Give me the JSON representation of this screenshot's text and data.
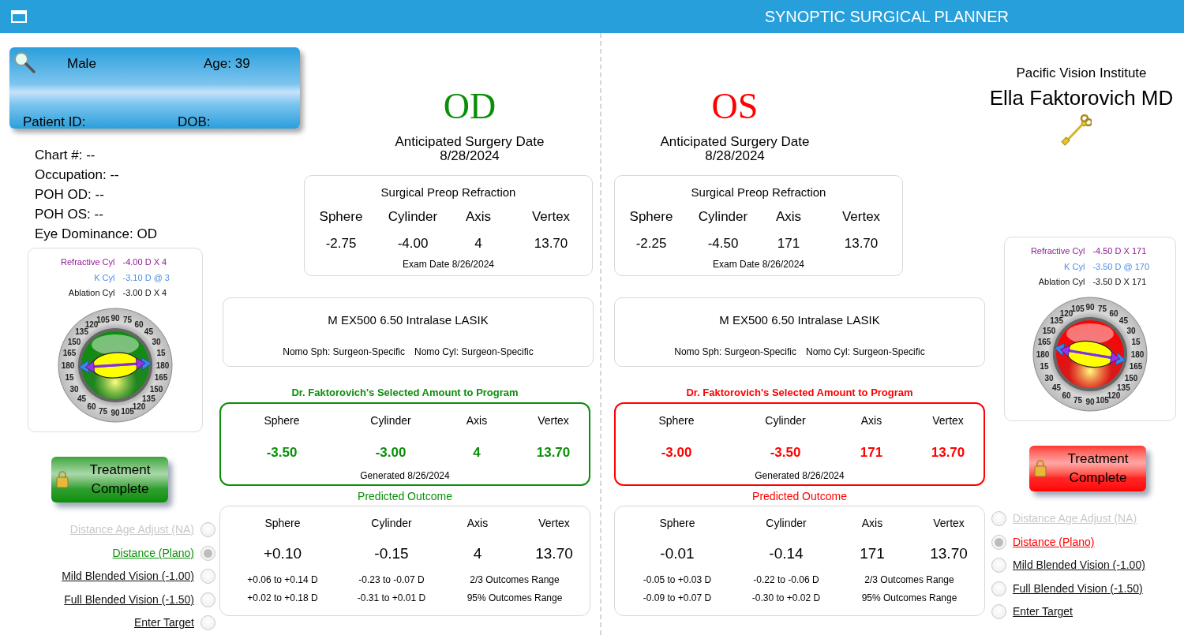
{
  "title_bar": {
    "title": "SYNOPTIC SURGICAL PLANNER"
  },
  "patient": {
    "sex": "Male",
    "age": "Age: 39",
    "patient_id": "Patient ID:",
    "dob": "DOB:"
  },
  "info": [
    "Chart #: --",
    "Occupation: --",
    "POH OD: --",
    "POH OS: --",
    "Eye Dominance: OD"
  ],
  "practice": {
    "name": "Pacific Vision Institute",
    "surgeon": "Ella Faktorovich MD"
  },
  "eyes": [
    {
      "label": "OD",
      "color": "#0a8f0a",
      "date_label": "Anticipated Surgery Date",
      "date": "8/28/2024",
      "preop": {
        "title": "Surgical Preop Refraction",
        "columns": [
          "Sphere",
          "Cylinder",
          "Axis",
          "Vertex"
        ],
        "values": [
          "-2.75",
          "-4.00",
          "4",
          "13.70"
        ],
        "footer": "Exam Date 8/26/2024"
      },
      "procedure": {
        "name": "M EX500 6.50 Intralase LASIK",
        "nomo_sph": "Nomo Sph: Surgeon-Specific",
        "nomo_cyl": "Nomo Cyl: Surgeon-Specific"
      },
      "selected": {
        "title": "Dr. Faktorovich's Selected Amount to Program",
        "columns": [
          "Sphere",
          "Cylinder",
          "Axis",
          "Vertex"
        ],
        "values": [
          "-3.50",
          "-3.00",
          "4",
          "13.70"
        ],
        "footer": "Generated 8/26/2024"
      },
      "predicted": {
        "title": "Predicted Outcome",
        "columns": [
          "Sphere",
          "Cylinder",
          "Axis",
          "Vertex"
        ],
        "values": [
          "+0.10",
          "-0.15",
          "4",
          "13.70"
        ],
        "ranges": [
          [
            "+0.06 to +0.14 D",
            "-0.23 to -0.07 D",
            "2/3 Outcomes Range"
          ],
          [
            "+0.02 to +0.18 D",
            "-0.31 to +0.01 D",
            "95% Outcomes Range"
          ]
        ]
      },
      "cyl": [
        {
          "kind": "refractive",
          "label": "Refractive Cyl",
          "value": "-4.00 D X 4"
        },
        {
          "kind": "k",
          "label": "K Cyl",
          "value": "-3.10 D @ 3"
        },
        {
          "kind": "ablation",
          "label": "Ablation Cyl",
          "value": "-3.00 D X 4"
        }
      ],
      "dial_labels": [
        "105",
        "90",
        "75",
        "120",
        "60",
        "135",
        "45",
        "150",
        "30",
        "165",
        "15",
        "180",
        "180",
        "15",
        "165",
        "30",
        "150",
        "45",
        "135",
        "60",
        "120",
        "75",
        "90",
        "105"
      ],
      "button": "Treatment Complete",
      "options": [
        {
          "label": "Distance Age Adjust (NA)",
          "selected": false,
          "disabled": true
        },
        {
          "label": "Distance (Plano)",
          "selected": true,
          "disabled": false
        },
        {
          "label": "Mild Blended Vision (-1.00)",
          "selected": false,
          "disabled": false
        },
        {
          "label": "Full Blended Vision (-1.50)",
          "selected": false,
          "disabled": false
        },
        {
          "label": "Enter Target",
          "selected": false,
          "disabled": false
        }
      ]
    },
    {
      "label": "OS",
      "color": "#ff0000",
      "date_label": "Anticipated Surgery Date",
      "date": "8/28/2024",
      "preop": {
        "title": "Surgical Preop Refraction",
        "columns": [
          "Sphere",
          "Cylinder",
          "Axis",
          "Vertex"
        ],
        "values": [
          "-2.25",
          "-4.50",
          "171",
          "13.70"
        ],
        "footer": "Exam Date 8/26/2024"
      },
      "procedure": {
        "name": "M EX500 6.50 Intralase LASIK",
        "nomo_sph": "Nomo Sph: Surgeon-Specific",
        "nomo_cyl": "Nomo Cyl: Surgeon-Specific"
      },
      "selected": {
        "title": "Dr. Faktorovich's Selected Amount to Program",
        "columns": [
          "Sphere",
          "Cylinder",
          "Axis",
          "Vertex"
        ],
        "values": [
          "-3.00",
          "-3.50",
          "171",
          "13.70"
        ],
        "footer": "Generated 8/26/2024"
      },
      "predicted": {
        "title": "Predicted Outcome",
        "columns": [
          "Sphere",
          "Cylinder",
          "Axis",
          "Vertex"
        ],
        "values": [
          "-0.01",
          "-0.14",
          "171",
          "13.70"
        ],
        "ranges": [
          [
            "-0.05 to +0.03 D",
            "-0.22 to -0.06 D",
            "2/3 Outcomes Range"
          ],
          [
            "-0.09 to +0.07 D",
            "-0.30 to +0.02 D",
            "95% Outcomes Range"
          ]
        ]
      },
      "cyl": [
        {
          "kind": "refractive",
          "label": "Refractive Cyl",
          "value": "-4.50 D X 171"
        },
        {
          "kind": "k",
          "label": "K Cyl",
          "value": "-3.50 D @ 170"
        },
        {
          "kind": "ablation",
          "label": "Ablation Cyl",
          "value": "-3.50 D X 171"
        }
      ],
      "dial_labels": [
        "105",
        "90",
        "75",
        "120",
        "60",
        "135",
        "45",
        "150",
        "30",
        "165",
        "15",
        "180",
        "180",
        "15",
        "165",
        "30",
        "150",
        "45",
        "135",
        "60",
        "120",
        "75",
        "90",
        "105"
      ],
      "button": "Treatment Complete",
      "options": [
        {
          "label": "Distance Age Adjust (NA)",
          "selected": false,
          "disabled": true
        },
        {
          "label": "Distance (Plano)",
          "selected": true,
          "disabled": false
        },
        {
          "label": "Mild Blended Vision (-1.00)",
          "selected": false,
          "disabled": false
        },
        {
          "label": "Full Blended Vision (-1.50)",
          "selected": false,
          "disabled": false
        },
        {
          "label": "Enter Target",
          "selected": false,
          "disabled": false
        }
      ]
    }
  ]
}
